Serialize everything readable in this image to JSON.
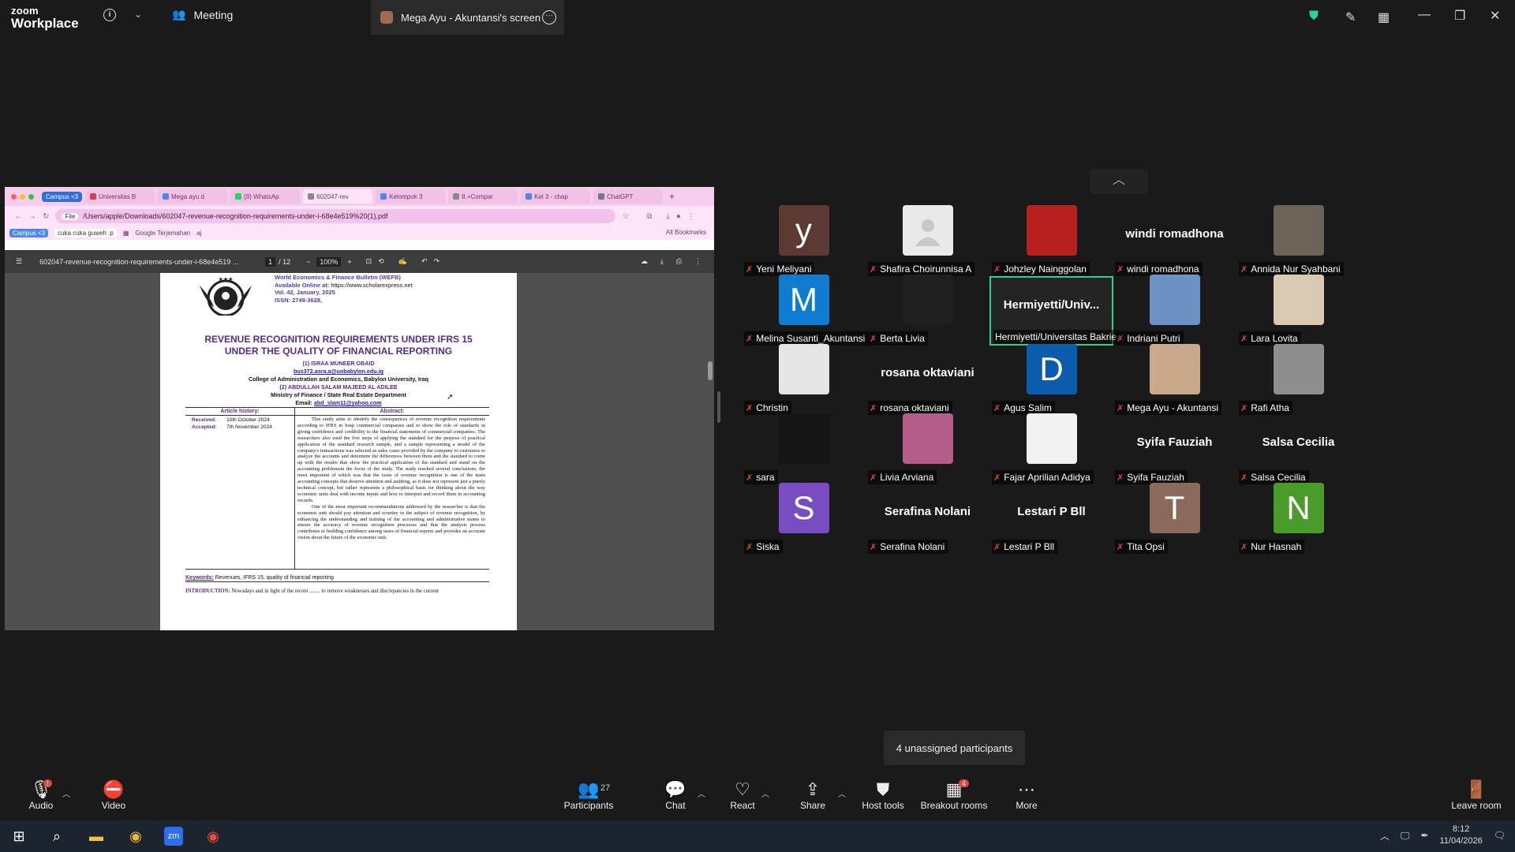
{
  "app": {
    "logo_line1": "zoom",
    "logo_line2": "Workplace",
    "meeting_tab": "Meeting",
    "share_tab": "Mega Ayu - Akuntansi's screen",
    "accent": "#2fd28a"
  },
  "browser": {
    "tab_group": "Campus <3",
    "tabs": [
      "Universitas B",
      "Mega ayu d",
      "(9) WhatsAp",
      "602047-rev",
      "Kelompok 3",
      "8.+Compar",
      "Kel 3 - chap",
      "ChatGPT"
    ],
    "url_chip": "File",
    "url": "/Users/apple/Downloads/602047-revenue-recognition-requirements-under-i-68e4e519%20(1).pdf",
    "bookmarks": [
      "Campus <3",
      "cuka cuka guweh :p",
      "Google Terjemahan",
      "aj"
    ],
    "all_bookmarks": "All Bookmarks"
  },
  "pdf": {
    "filename": "602047-revenue-recognition-requirements-under-i-68e4e519 ...",
    "page_current": "1",
    "page_total": "/ 12",
    "zoom": "100%",
    "journal_name": "World Economics & Finance Bulletin (WEFB)",
    "available_label": "Available Online at:",
    "available_url": "https://www.scholarexpress.net",
    "volume": "Vol. 42, January, 2025",
    "issn": "ISSN: 2749-3628,",
    "title_line1": "REVENUE RECOGNITION REQUIREMENTS UNDER IFRS 15",
    "title_line2": "UNDER THE QUALITY OF FINANCIAL REPORTING",
    "author1": "(1) ISRAA MUNEER OBAID",
    "author1_email": "bus372.asra.a@uobabylon.edu.iq",
    "affiliation1": "College of Administration and Economics, Babylon University, Iraq",
    "author2": "(2) ABDULLAH SALAM MAJEED AL ADILEE",
    "affiliation2": "Ministry of Finance / State Real Estate Department",
    "email_label": "Email:",
    "author2_email": "abd_slam11@yahoo.com",
    "history_header": "Article history:",
    "abstract_header": "Abstract:",
    "received_label": "Received:",
    "received_date": "10th October 2024",
    "accepted_label": "Accepted:",
    "accepted_date": "7th November 2024",
    "abstract_p1": "This study aims to identify the consequences of revenue recognition requirements according to IFRS in Iraqi commercial companies and to show the role of standards in giving confidence and credibility to the financial statements of commercial companies. The researchers also used the five steps of applying the standard for the purpose of practical application of the standard research sample, and a sample representing a model of the company's transactions was selected as sales cases provided by the company to customers to analyze the accounts and determine the differences between them and the standard to come up with the results that show the practical application of the standard and stand on the accounting problemsin the focus of the study. The study reached several conclusions, the most important of which was that the issue of revenue recognition is one of the main accounting concepts that deserve attention and auditing, as it does not represent just a purely technical concept, but rather represents a philosophical basis for thinking about the way economic units deal with income inputs and how to interpret and record them in accounting records.",
    "abstract_p2": "One of the most important recommendations addressed by the researcher is that the economic unit should pay attention and scrutiny in the subject of revenue recognition, by enhancing the understanding and training of the accounting and administrative teams to ensure the accuracy of revenue recognition processes and that the analysis process contributes to building confidence among users of financial reports and provides an accurate vision about the future of the economic unit.",
    "keywords_label": "Keywords:",
    "keywords": "Revenues, IFRS 15, quality of financial reporting",
    "intro_label": "INTRODUCTION:",
    "intro_text": "Nowadays and in light of the recent ........ to remove weaknesses and discrepancies in the current"
  },
  "participants": [
    {
      "name": "Yeni Meliyani",
      "initial": "y",
      "color": "#5c3a33"
    },
    {
      "name": "Shafira Choirunnisa A",
      "photo": "placeholder"
    },
    {
      "name": "Johzley Nainggolan",
      "photo": "red"
    },
    {
      "name": "windi romadhona",
      "big": "windi romadhona"
    },
    {
      "name": "Annida Nur Syahbani",
      "photo": "texture"
    },
    {
      "name": "Melina Susanti_Akuntansi",
      "initial": "M",
      "color": "#0e7ccf"
    },
    {
      "name": "Berta Livia",
      "photo": "dark"
    },
    {
      "name": "Hermiyetti/Universitas Bakrie",
      "big": "Hermiyetti/Univ...",
      "active": true
    },
    {
      "name": "Indriani Putri",
      "photo": "city"
    },
    {
      "name": "Lara Lovita",
      "photo": "beige"
    },
    {
      "name": "Christin",
      "photo": "light"
    },
    {
      "name": "rosana oktaviani",
      "big": "rosana oktaviani"
    },
    {
      "name": "Agus Salim",
      "initial": "D",
      "color": "#0b5cad"
    },
    {
      "name": "Mega Ayu - Akuntansi",
      "photo": "cat"
    },
    {
      "name": "Rafi Atha",
      "photo": "bw"
    },
    {
      "name": "sara",
      "photo": "dark2"
    },
    {
      "name": "Livia Arviana",
      "photo": "event"
    },
    {
      "name": "Fajar Aprilian Adidya",
      "photo": "white"
    },
    {
      "name": "Syifa Fauziah",
      "big": "Syifa Fauziah"
    },
    {
      "name": "Salsa Cecilia",
      "big": "Salsa Cecilia"
    },
    {
      "name": "Siska",
      "initial": "S",
      "color": "#7a4cc2"
    },
    {
      "name": "Serafina Nolani",
      "big": "Serafina Nolani"
    },
    {
      "name": "Lestari P Bll",
      "big": "Lestari P Bll"
    },
    {
      "name": "Tita Opsi",
      "initial": "T",
      "color": "#8b6a5c"
    },
    {
      "name": "Nur Hasnah",
      "initial": "N",
      "color": "#4a9a2c"
    }
  ],
  "unassigned": "4 unassigned participants",
  "toolbar": {
    "audio": "Audio",
    "audio_badge": "!",
    "video": "Video",
    "participants": "Participants",
    "participants_count": "27",
    "chat": "Chat",
    "react": "React",
    "share": "Share",
    "host_tools": "Host tools",
    "breakout": "Breakout rooms",
    "breakout_badge": "4",
    "more": "More",
    "leave": "Leave room"
  },
  "taskbar": {
    "time": "8:12",
    "date": "11/04/2026",
    "notif": "1"
  }
}
